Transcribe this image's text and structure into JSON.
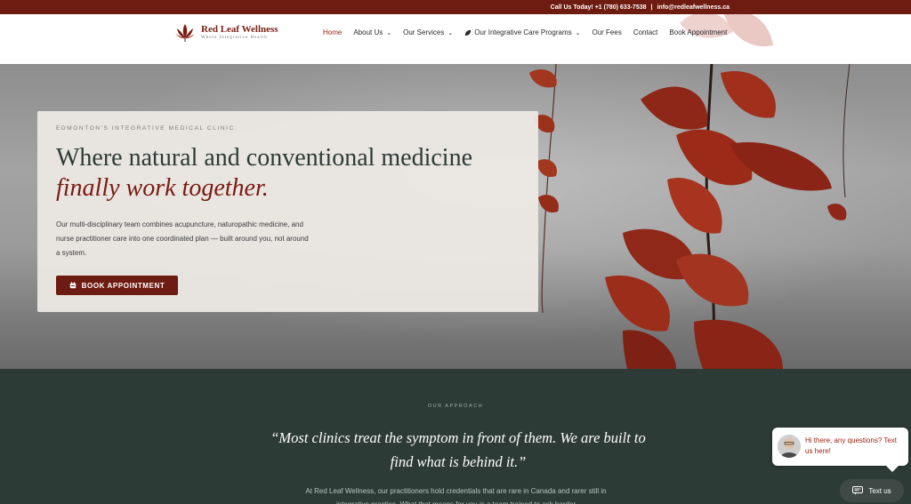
{
  "topbar": {
    "call_text": "Call Us Today! +1 (780) 633-7538",
    "separator": "|",
    "email": "info@redleafwellness.ca"
  },
  "brand": {
    "name": "Red Leaf Wellness",
    "tagline": "Whole Integrative Health"
  },
  "nav": {
    "items": [
      {
        "label": "Home",
        "has_dropdown": false,
        "active": true
      },
      {
        "label": "About Us",
        "has_dropdown": true
      },
      {
        "label": "Our Services",
        "has_dropdown": true
      },
      {
        "label": "Our Integrative Care Programs",
        "has_dropdown": true,
        "icon": "leaf-icon"
      },
      {
        "label": "Our Fees",
        "has_dropdown": false
      },
      {
        "label": "Contact",
        "has_dropdown": false
      },
      {
        "label": "Book Appointment",
        "has_dropdown": false
      }
    ],
    "chevron": "⌄"
  },
  "hero": {
    "eyebrow": "EDMONTON'S INTEGRATIVE MEDICAL CLINIC",
    "headline": "Where natural and conventional medicine",
    "headline_accent": "finally work together.",
    "body": "Our multi-disciplinary team combines acupuncture, naturopathic medicine, and nurse practitioner care into one coordinated plan — built around you, not around a system.",
    "cta_label": "BOOK APPOINTMENT",
    "cta_icon": "calendar-icon"
  },
  "approach": {
    "eyebrow": "OUR APPROACH",
    "quote": "“Most clinics treat the symptom in front of them. We are built to find what is behind it.”",
    "body": "At Red Leaf Wellness, our practitioners hold credentials that are rare in Canada and rarer still in integrative practice. What that means for you is a team trained to ask harder"
  },
  "chat": {
    "greeting": "Hi there, any questions? Text us here!",
    "button_label": "Text us",
    "button_icon": "message-icon"
  },
  "colors": {
    "brand_red": "#6e1b11",
    "accent_red": "#7a1a10",
    "dark_green": "#2d3b36",
    "card_bg": "#ece9e5"
  }
}
